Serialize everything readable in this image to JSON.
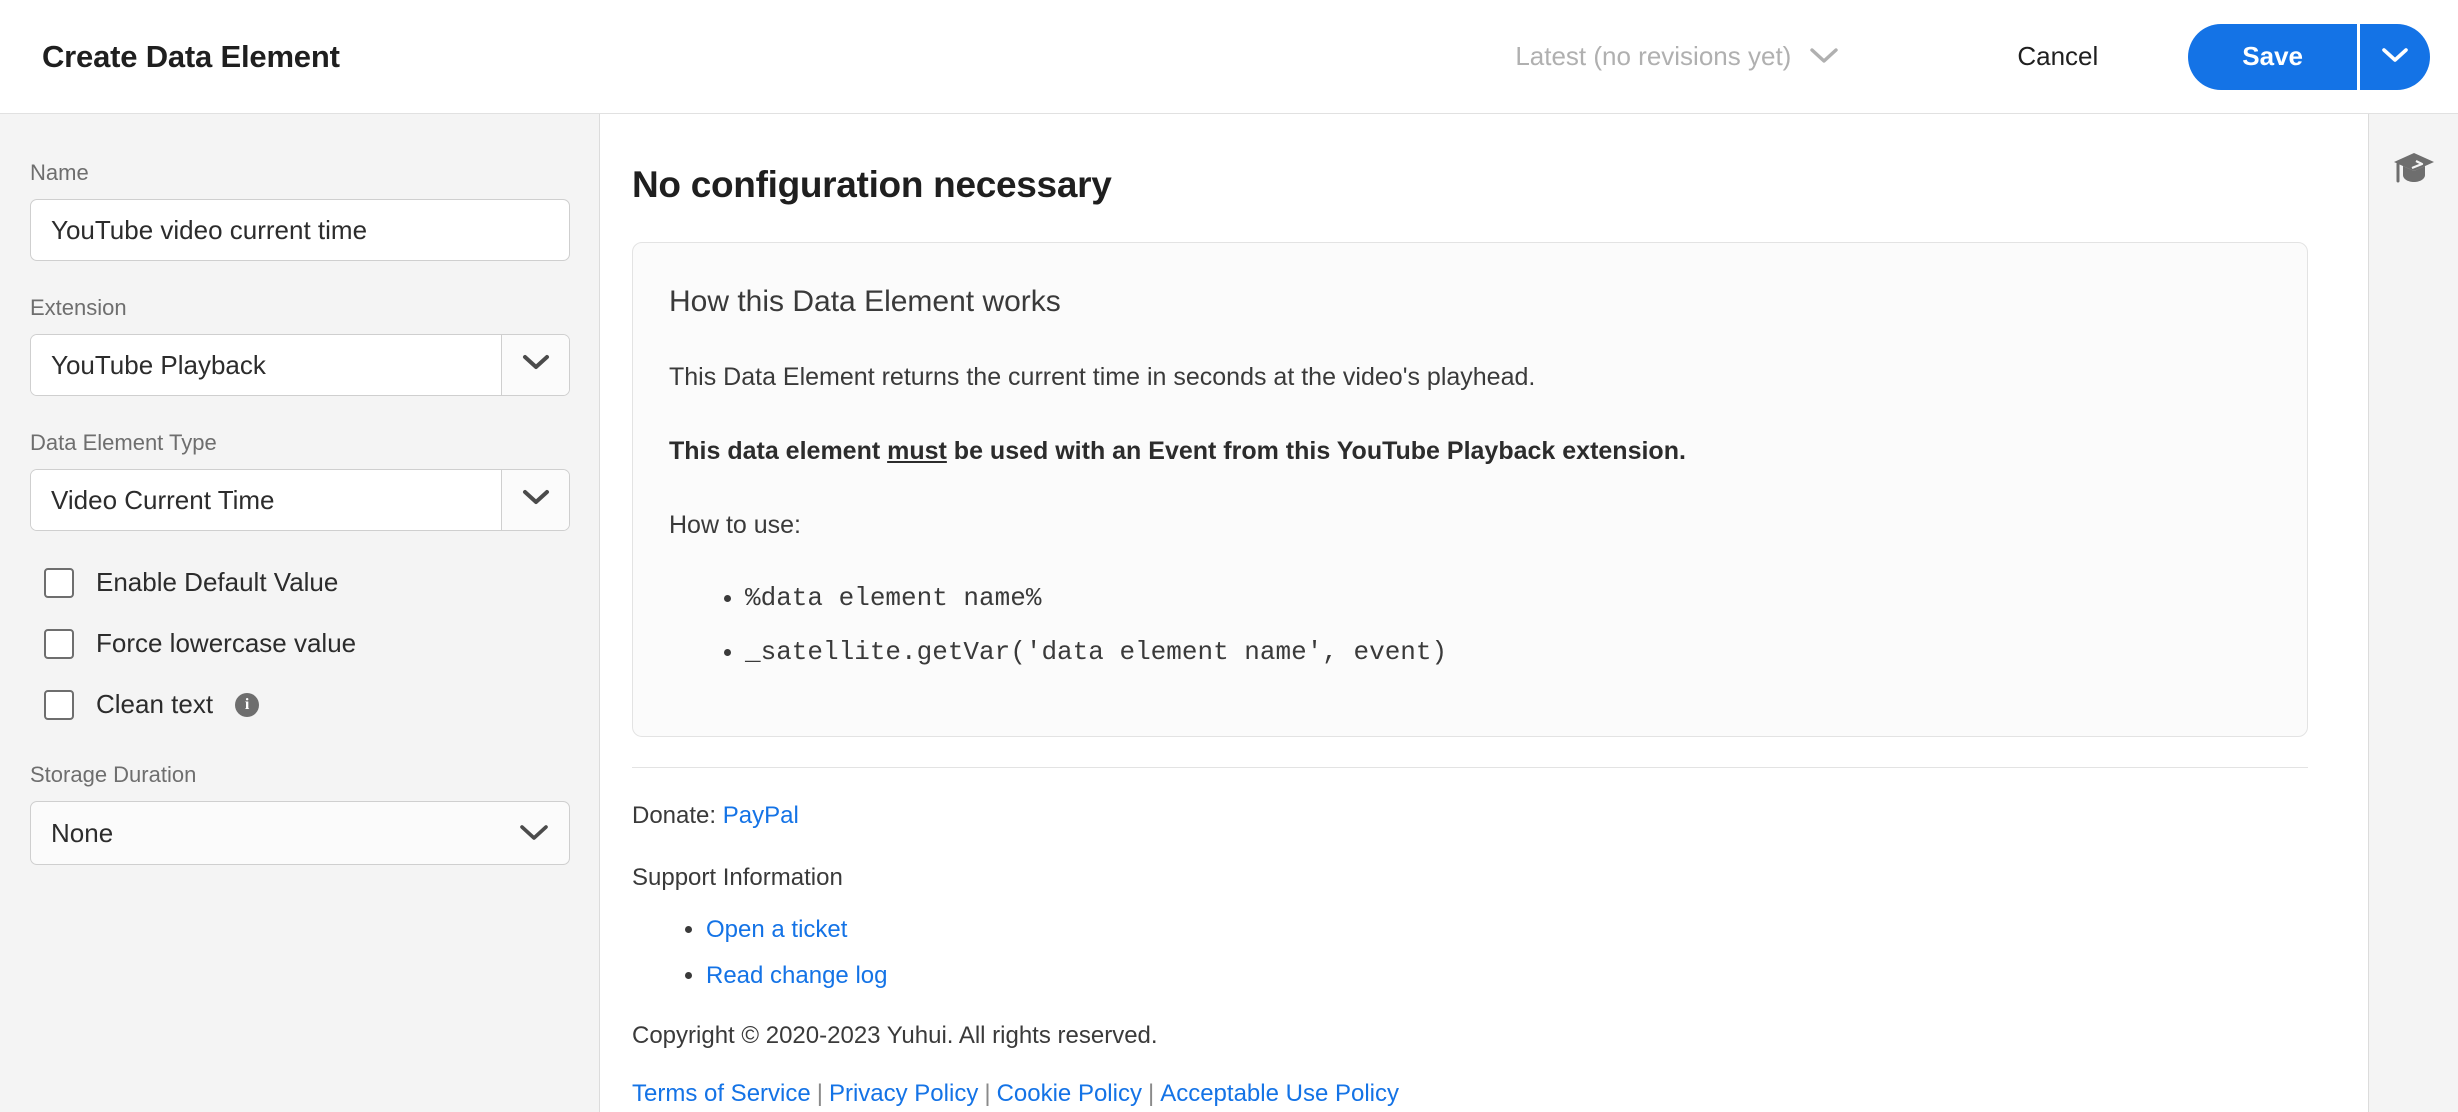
{
  "header": {
    "title": "Create Data Element",
    "revision_label": "Latest (no revisions yet)",
    "cancel_label": "Cancel",
    "save_label": "Save",
    "accent_color": "#1473E6"
  },
  "sidebar": {
    "name": {
      "label": "Name",
      "value": "YouTube video current time",
      "placeholder": ""
    },
    "extension": {
      "label": "Extension",
      "value": "YouTube Playback"
    },
    "data_element_type": {
      "label": "Data Element Type",
      "value": "Video Current Time"
    },
    "checkboxes": [
      {
        "label": "Enable Default Value",
        "checked": false
      },
      {
        "label": "Force lowercase value",
        "checked": false
      },
      {
        "label": "Clean text",
        "checked": false,
        "has_info": true
      }
    ],
    "storage_duration": {
      "label": "Storage Duration",
      "value": "None"
    }
  },
  "main": {
    "title": "No configuration necessary",
    "card": {
      "heading": "How this Data Element works",
      "paragraph": "This Data Element returns the current time in seconds at the video's playhead.",
      "requirement_prefix": "This data element ",
      "requirement_emphasis": "must",
      "requirement_suffix": " be used with an Event from this YouTube Playback extension.",
      "how_to_use_label": "How to use:",
      "usage": [
        "%data element name%",
        "_satellite.getVar('data element name', event)"
      ]
    },
    "footer": {
      "donate_label": "Donate:",
      "donate_link": "PayPal",
      "support_heading": "Support Information",
      "support_links": [
        "Open a ticket",
        "Read change log"
      ],
      "copyright": "Copyright © 2020-2023 Yuhui. All rights reserved.",
      "policy_links": [
        "Terms of Service",
        "Privacy Policy",
        "Cookie Policy",
        "Acceptable Use Policy"
      ],
      "policy_separator": "|",
      "link_color": "#1473E6"
    }
  },
  "right_rail": {
    "icon": "graduation-cap-icon"
  }
}
